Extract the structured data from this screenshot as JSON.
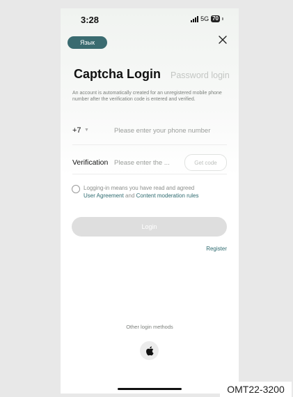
{
  "status_bar": {
    "time": "3:28",
    "network": "5G",
    "battery": "70"
  },
  "header": {
    "language_label": "Язык",
    "close_icon": "close-icon"
  },
  "tabs": {
    "captcha": "Captcha Login",
    "password": "Password login"
  },
  "notice": "An account is automatically created for an unregistered mobile phone number after the verification code is entered and verified.",
  "phone": {
    "country_code": "+7",
    "placeholder": "Please enter your phone number",
    "value": ""
  },
  "verification": {
    "label": "Verification",
    "placeholder": "Please enter the ...",
    "value": "",
    "get_code": "Get code"
  },
  "agreement": {
    "checked": false,
    "text_1": "Logging-in means you have read and agreed",
    "link_1": "User Agreement",
    "joiner": "and",
    "link_2": "Content moderation rules"
  },
  "login_button": "Login",
  "register_link": "Register",
  "other_login": {
    "label": "Other login methods",
    "icon": "apple-icon"
  },
  "watermark": "OMT22-3200",
  "colors": {
    "accent": "#2d6a6f",
    "lang_button_bg": "#3a6b70",
    "login_disabled_bg": "#dedede"
  }
}
